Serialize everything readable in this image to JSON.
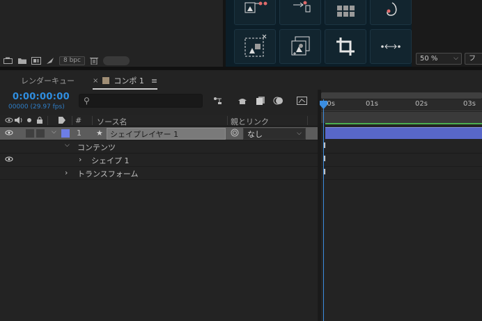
{
  "project_panel": {
    "bpc_label": "8 bpc",
    "icons": [
      "interpret-footage-icon",
      "new-folder-icon",
      "new-composition-icon",
      "flowchart-icon",
      "trash-icon"
    ]
  },
  "tools_panel": {
    "icons": [
      "align-move-icon",
      "path-anchor-icon",
      "grid-icon",
      "hook-icon",
      "selection-shape-icon",
      "layers-stack-icon",
      "crop-icon",
      "distribute-horizontal-icon"
    ]
  },
  "viewer": {
    "zoom": "50 %",
    "extra": "フ"
  },
  "tabs": {
    "render_queue": "レンダーキュー",
    "close": "×",
    "comp_name": "コンポ 1",
    "menu": "≡"
  },
  "timeline": {
    "timecode": "0:00:00:00",
    "frames_fps": "00000 (29.97 fps)",
    "search_glyph": "⚲",
    "columns": {
      "hash": "#",
      "source_name": "ソース名",
      "parent_link": "親とリンク"
    },
    "layer": {
      "number": "1",
      "name": "シェイプレイヤー 1",
      "parent_value": "なし"
    },
    "tree": {
      "contents": "コンテンツ",
      "shape": "シェイプ 1",
      "transform": "トランスフォーム"
    },
    "ruler_ticks": [
      "00s",
      "01s",
      "02s",
      "03s"
    ],
    "keyframe_marker": "I"
  },
  "colors": {
    "accent_blue": "#2f8ee0",
    "layer_label": "#6d7ee6",
    "layer_bar": "#5867c8",
    "comp_swatch": "#a08e75",
    "work_area_green": "#4caf50"
  }
}
